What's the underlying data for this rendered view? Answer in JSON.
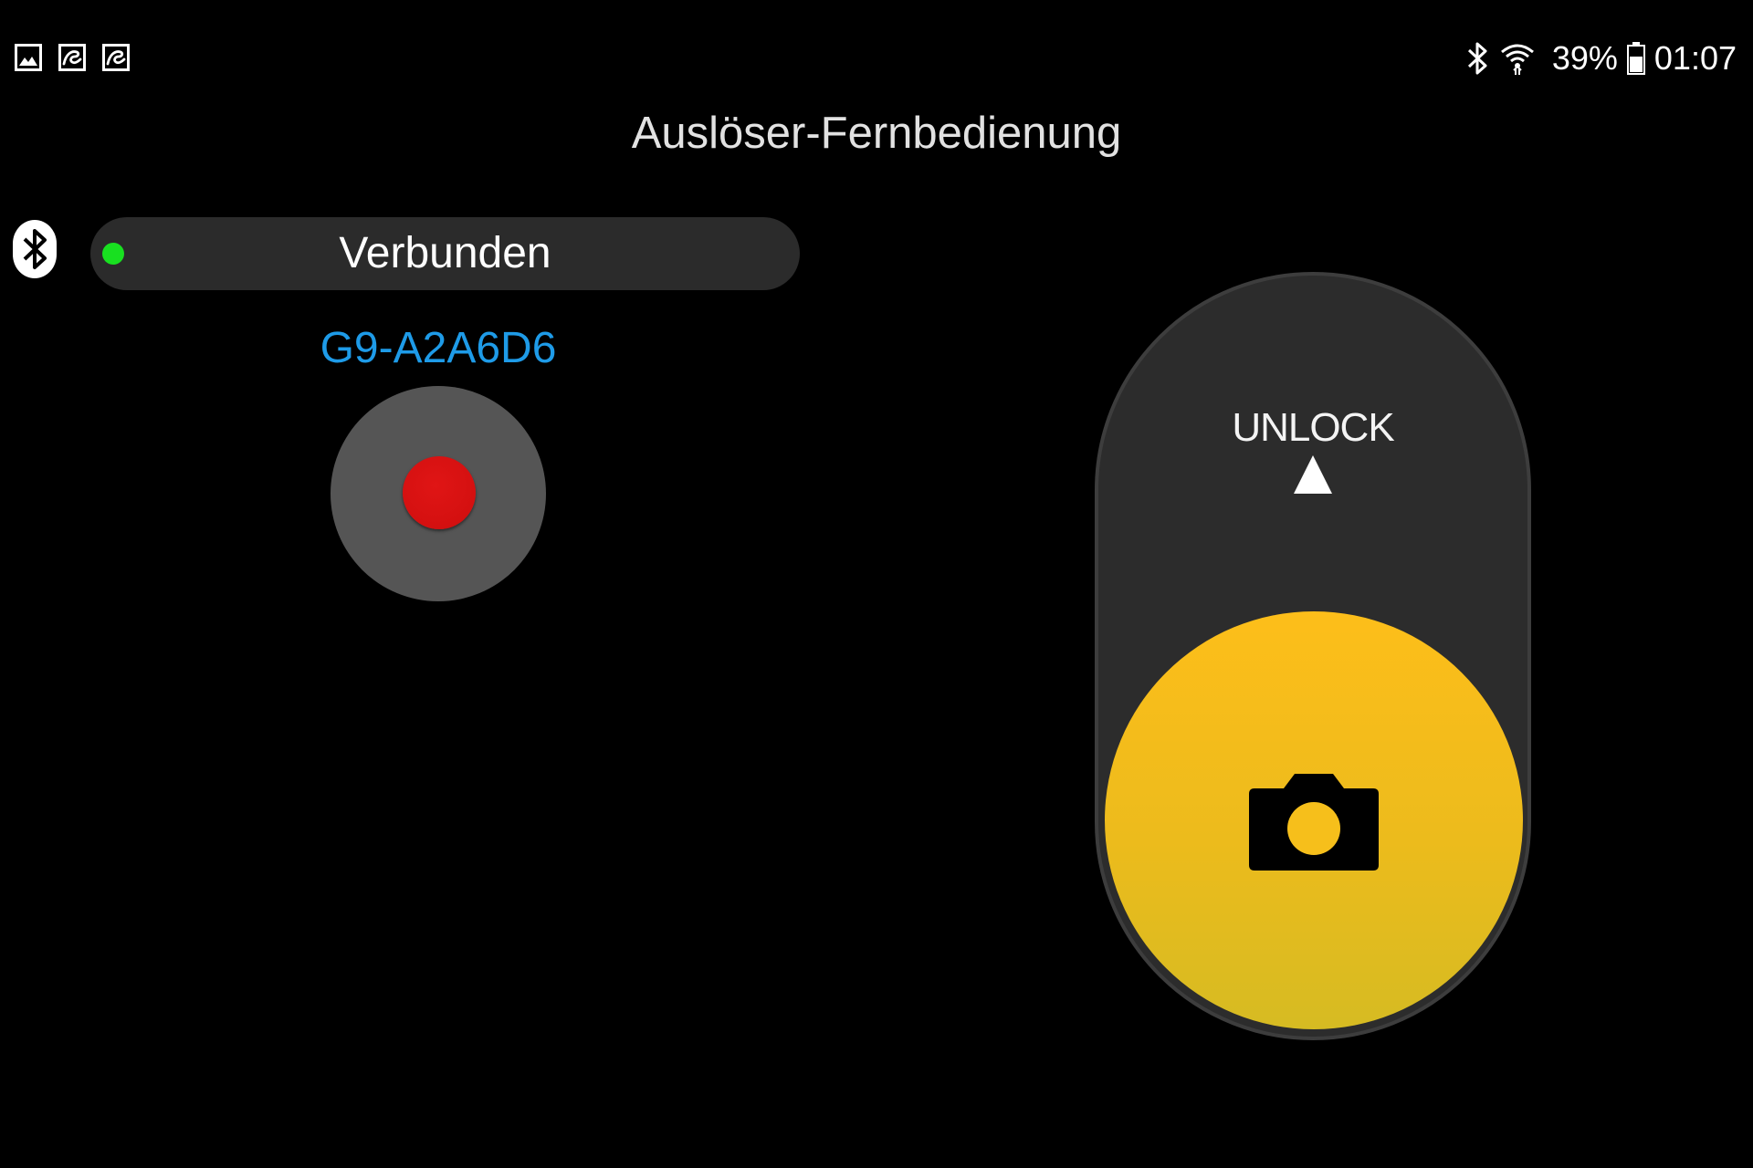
{
  "status_bar": {
    "notification_icons": [
      "gallery-icon",
      "app-notification-icon",
      "app-notification-icon"
    ],
    "bluetooth_icon": "bluetooth-icon",
    "wifi_icon": "wifi-icon",
    "battery_percent": "39%",
    "battery_icon": "battery-icon",
    "time": "01:07"
  },
  "page": {
    "title": "Auslöser-Fernbedienung"
  },
  "connection": {
    "bluetooth_icon": "bluetooth-icon",
    "status_label": "Verbunden",
    "status_color": "#18e020",
    "device_name": "G9-A2A6D6",
    "device_name_color": "#1e9be8"
  },
  "record_button": {
    "icon": "record-icon",
    "color": "#d41010"
  },
  "shutter": {
    "unlock_label": "UNLOCK",
    "arrow_icon": "arrow-up-icon",
    "icon": "camera-icon",
    "color": "#fdbe1a"
  }
}
